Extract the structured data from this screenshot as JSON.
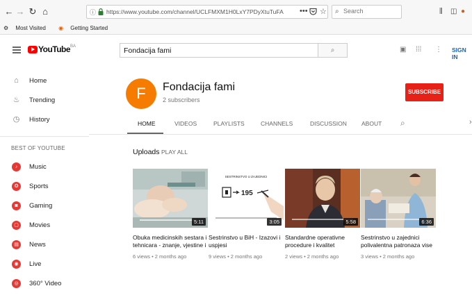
{
  "browser": {
    "url": "https://www.youtube.com/channel/UCLFMXM1H0LxY7PDyXtuTuFA",
    "search_placeholder": "Search",
    "bookmarks": [
      "Most Visited",
      "Getting Started"
    ]
  },
  "youtube": {
    "logo_text": "YouTube",
    "logo_region": "BA",
    "search_value": "Fondacija fami",
    "sign_in": "SIGN IN"
  },
  "sidebar": {
    "items": [
      {
        "label": "Home",
        "icon": "home-icon"
      },
      {
        "label": "Trending",
        "icon": "trending-icon"
      },
      {
        "label": "History",
        "icon": "history-icon"
      }
    ],
    "section_title": "BEST OF YOUTUBE",
    "best_items": [
      {
        "label": "Music",
        "icon": "music-icon"
      },
      {
        "label": "Sports",
        "icon": "sports-icon"
      },
      {
        "label": "Gaming",
        "icon": "gaming-icon"
      },
      {
        "label": "Movies",
        "icon": "movies-icon"
      },
      {
        "label": "News",
        "icon": "news-icon"
      },
      {
        "label": "Live",
        "icon": "live-icon"
      },
      {
        "label": "360° Video",
        "icon": "360-video-icon"
      }
    ]
  },
  "channel": {
    "avatar_letter": "F",
    "name": "Fondacija fami",
    "subscribers": "2 subscribers",
    "subscribe_label": "SUBSCRIBE",
    "avatar_color": "#f57c00"
  },
  "tabs": [
    "HOME",
    "VIDEOS",
    "PLAYLISTS",
    "CHANNELS",
    "DISCUSSION",
    "ABOUT"
  ],
  "active_tab": "HOME",
  "uploads": {
    "title": "Uploads",
    "play_all": "PLAY ALL",
    "videos": [
      {
        "title": "Obuka medicinskih sestara i tehnicara - znanje, vjestine i",
        "duration": "5:11",
        "meta": "6 views • 2 months ago"
      },
      {
        "title": "Sestrinstvo u BiH - Izazovi i uspjesi",
        "duration": "3:05",
        "meta": "9 views • 2 months ago",
        "thumb_text": "195",
        "thumb_caption": "SESTRINSTVO U ZAJEDNICI"
      },
      {
        "title": "Standardne operativne procedure i kvalitet",
        "duration": "5:58",
        "meta": "2 views • 2 months ago"
      },
      {
        "title": "Sestrinstvo u zajednici polivalentna patronaza vise",
        "duration": "6:36",
        "meta": "3 views • 2 months ago"
      }
    ]
  },
  "colors": {
    "brand_red": "#ff0000",
    "subscribe_red": "#e62117",
    "link_blue": "#1565c0"
  }
}
